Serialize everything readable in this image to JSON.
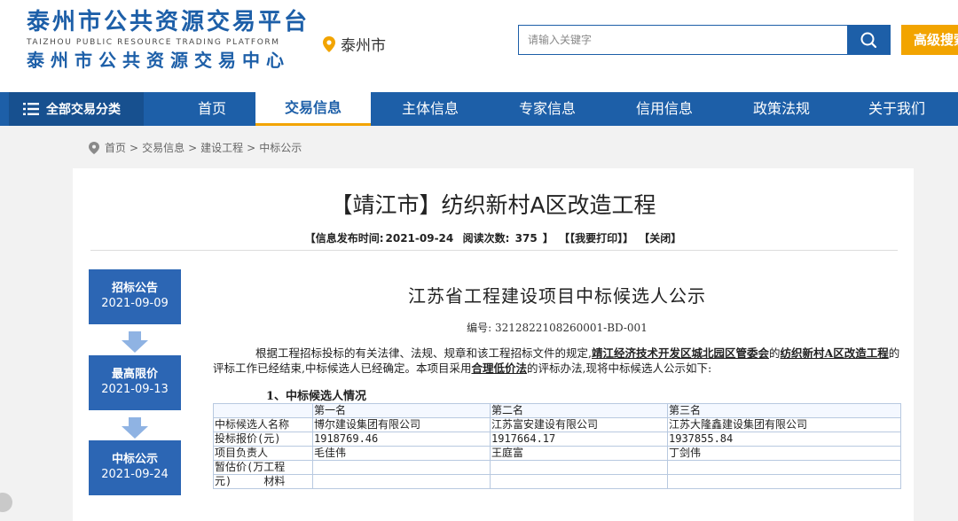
{
  "header": {
    "logo_cn": "泰州市公共资源交易平台",
    "logo_en": "TAIZHOU PUBLIC RESOURCE TRADING PLATFORM",
    "logo_cn2": "泰州市公共资源交易中心",
    "city": "泰州市",
    "search_placeholder": "请输入关键字",
    "advanced_search": "高级搜索",
    "brand_color": "#1d5fa8",
    "accent_color": "#f2a400"
  },
  "nav": {
    "all_categories": "全部交易分类",
    "items": [
      {
        "label": "首页"
      },
      {
        "label": "交易信息"
      },
      {
        "label": "主体信息"
      },
      {
        "label": "专家信息"
      },
      {
        "label": "信用信息"
      },
      {
        "label": "政策法规"
      },
      {
        "label": "关于我们"
      }
    ],
    "active": "交易信息"
  },
  "breadcrumb": {
    "items": [
      "首页",
      "交易信息",
      "建设工程",
      "中标公示"
    ],
    "separator": ">"
  },
  "article": {
    "title": "【靖江市】纺织新村A区改造工程",
    "meta_publish_label": "【信息发布时间:",
    "meta_publish_date": "2021-09-24",
    "meta_read_label": "阅读次数:",
    "meta_read_count": "375",
    "meta_read_end": "】",
    "meta_print": "【【我要打印】】",
    "meta_close": "【关闭】"
  },
  "timeline": [
    {
      "label": "招标公告",
      "date": "2021-09-09"
    },
    {
      "label": "最高限价",
      "date": "2021-09-13"
    },
    {
      "label": "中标公示",
      "date": "2021-09-24"
    }
  ],
  "content": {
    "heading": "江苏省工程建设项目中标候选人公示",
    "number": "编号: 3212822108260001-BD-001",
    "para_1": "根据工程招标投标的有关法律、法规、规章和该工程招标文件的规定,",
    "para_owner": "靖江经济技术开发区城北园区管委会",
    "para_2": "的",
    "para_project": "纺织新村A区改造工程",
    "para_3": "的评标工作已经结束,中标候选人已经确定。本项目采用",
    "para_method": "合理低价法",
    "para_4": "的评标办法,现将中标候选人公示如下:",
    "section_1": "1、中标候选人情况",
    "table": {
      "header": [
        "",
        "第一名",
        "第二名",
        "第三名"
      ],
      "rows": [
        [
          "中标候选人名称",
          "博尔建设集团有限公司",
          "江苏富安建设有限公司",
          "江苏大隆鑫建设集团有限公司"
        ],
        [
          "投标报价(元)",
          "1918769.46",
          "1917664.17",
          "1937855.84"
        ],
        [
          "项目负责人",
          "毛佳伟",
          "王庭富",
          "丁剑伟"
        ]
      ],
      "last_row_label_1": "暂估价(万工程",
      "last_row_label_2": "元)",
      "last_row_label_3": "材料"
    }
  }
}
